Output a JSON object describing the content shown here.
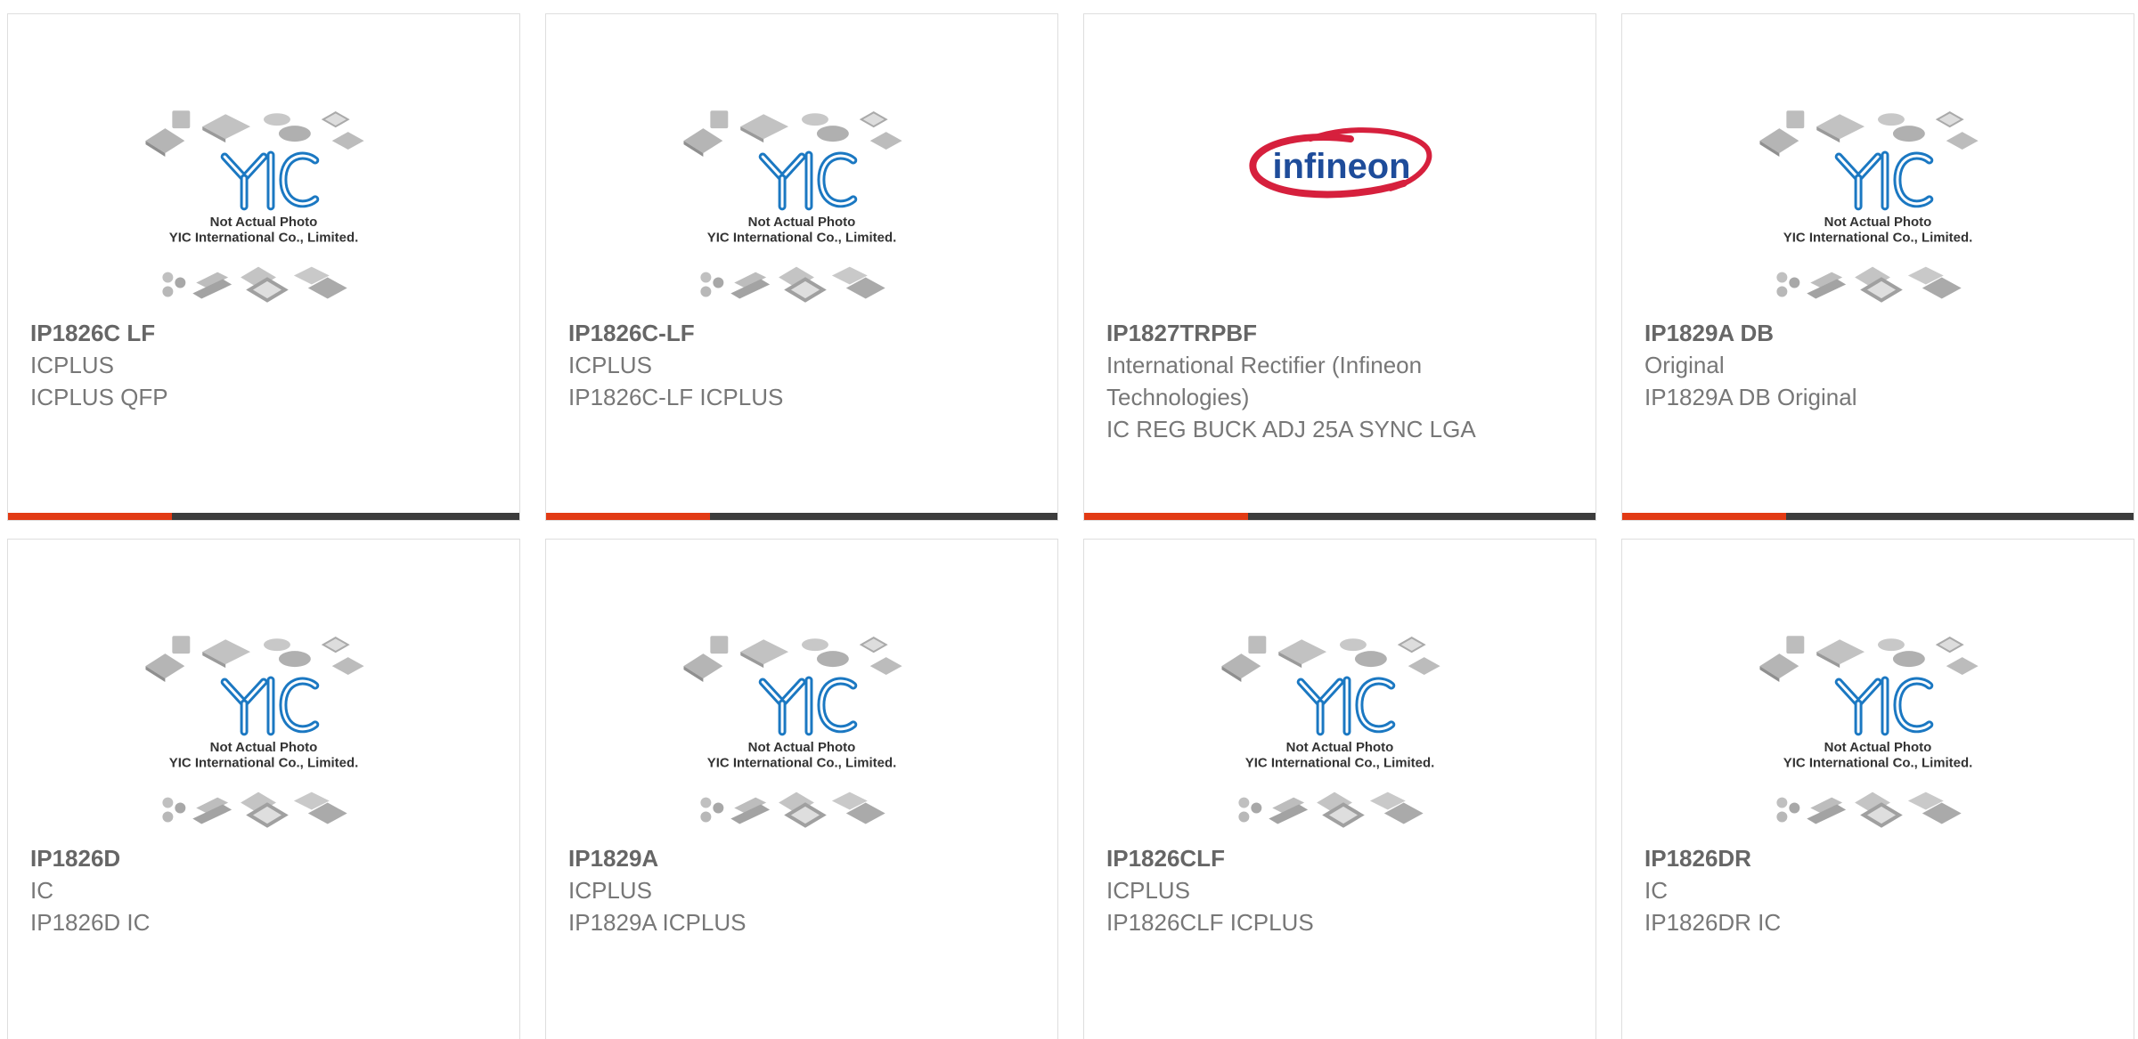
{
  "theme": {
    "accent": "#e23a14",
    "bar": "#3c3c3c",
    "yic_blue": "#1b78c2",
    "infineon_red": "#d6203d",
    "infineon_blue": "#1e4c9a"
  },
  "placeholder": {
    "line1": "Not Actual Photo",
    "line2": "YIC International Co., Limited.",
    "logo_text": "YIC"
  },
  "infineon_logo": {
    "text": "infineon"
  },
  "products": [
    {
      "pn": "IP1826C LF",
      "mfr": "ICPLUS",
      "desc": "ICPLUS QFP",
      "image": "yic-placeholder"
    },
    {
      "pn": "IP1826C-LF",
      "mfr": "ICPLUS",
      "desc": "IP1826C-LF ICPLUS",
      "image": "yic-placeholder"
    },
    {
      "pn": "IP1827TRPBF",
      "mfr": "International Rectifier (Infineon Technologies)",
      "desc": "IC REG BUCK ADJ 25A SYNC LGA",
      "image": "infineon-logo"
    },
    {
      "pn": "IP1829A DB",
      "mfr": "Original",
      "desc": "IP1829A DB Original",
      "image": "yic-placeholder"
    },
    {
      "pn": "IP1826D",
      "mfr": "IC",
      "desc": "IP1826D IC",
      "image": "yic-placeholder"
    },
    {
      "pn": "IP1829A",
      "mfr": "ICPLUS",
      "desc": "IP1829A ICPLUS",
      "image": "yic-placeholder"
    },
    {
      "pn": "IP1826CLF",
      "mfr": "ICPLUS",
      "desc": "IP1826CLF ICPLUS",
      "image": "yic-placeholder"
    },
    {
      "pn": "IP1826DR",
      "mfr": "IC",
      "desc": "IP1826DR IC",
      "image": "yic-placeholder"
    }
  ]
}
